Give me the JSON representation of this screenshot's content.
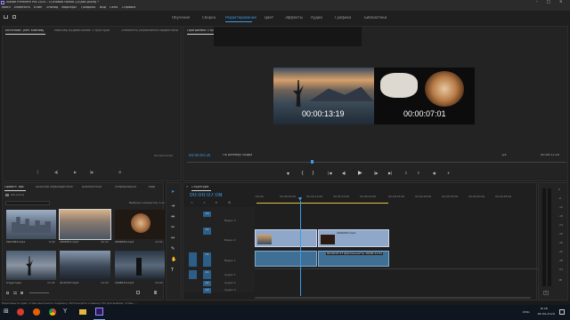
{
  "window": {
    "title": "Adobe Premiere Pro 2020 - D:\\Новая папка (2)\\abc.prproj *"
  },
  "menu": [
    "Файл",
    "Изменить",
    "Клип",
    "Эпизод",
    "Маркеры",
    "Графика",
    "Вид",
    "Окно",
    "Справка"
  ],
  "workspaces": [
    "Обучение",
    "Сборка",
    "Редактирование",
    "Цвет",
    "Эффекты",
    "Аудио",
    "Графика",
    "Библиотеки"
  ],
  "active_workspace": "Редактирование",
  "source_panel": {
    "tabs": [
      "Источник: (нет клипов)",
      "Микшер аудиоклипов: Структура",
      "Элементы управления эффектами"
    ],
    "timecode_right": "00:00:00:00"
  },
  "program_panel": {
    "tab": "Программа: Структура",
    "overlay_times": [
      "00:00:13:19",
      "00:00:07:01"
    ],
    "timecode_left": "00:00:00:20",
    "fit": "По размеру кадра",
    "zoom": "1/4",
    "timecode_right": "00:00:11:20"
  },
  "project_panel": {
    "tabs": [
      "Проект: abc",
      "Браузер медиаданных",
      "Библиотеки",
      "Информация",
      "Эфф"
    ],
    "filename": "abc.prproj",
    "selection_info": "Выбрано элементов: 1 из 6",
    "items": [
      {
        "name": "2627963.mp4",
        "dur": "6:06"
      },
      {
        "name": "2606351.mp4",
        "dur": "26:20"
      },
      {
        "name": "2606345.mp4",
        "dur": "10:01"
      },
      {
        "name": "Структура",
        "dur": "12:05"
      },
      {
        "name": "2147127.mp4",
        "dur": "10:04"
      },
      {
        "name": "2408170.mp4",
        "dur": "10:00"
      }
    ]
  },
  "timeline": {
    "tab": "Структура",
    "timecode": "00:00:07:08",
    "ruler": [
      ":00:00",
      "00:00:05:00",
      "00:00:10:00",
      "00:00:15:00",
      "00:00:20:00",
      "00:00:25:00",
      "00:00:30:00",
      "00:00:35:00",
      "00:00:40:00",
      "00:00:45:00"
    ],
    "tracks": [
      {
        "label": "V3",
        "name": "Видео 3"
      },
      {
        "label": "V2",
        "name": "Видео 2"
      },
      {
        "label": "V1",
        "name": "Видео 1"
      },
      {
        "label": "A1",
        "name": "Аудио 1"
      },
      {
        "label": "A2",
        "name": "Аудио 2"
      },
      {
        "label": "A3",
        "name": "Аудио 3"
      }
    ],
    "clip_label": "2606345.mp4",
    "tooltip": "00:00:07:17  Длительность: 00:00:11:21"
  },
  "audio_meter": {
    "labels": [
      "0",
      "-6",
      "-12",
      "-18",
      "-24",
      "-30",
      "-36",
      "-42",
      "-48",
      "-54",
      "dB"
    ],
    "solo": "S"
  },
  "status_bar": {
    "text": "Перетащите край, чтобы выполнить подрезку. Используйте клавишу Ctrl для выбора, чтобы ..."
  },
  "taskbar": {
    "time": "8:26",
    "date": "16.04.2020",
    "lang": "ENG"
  }
}
